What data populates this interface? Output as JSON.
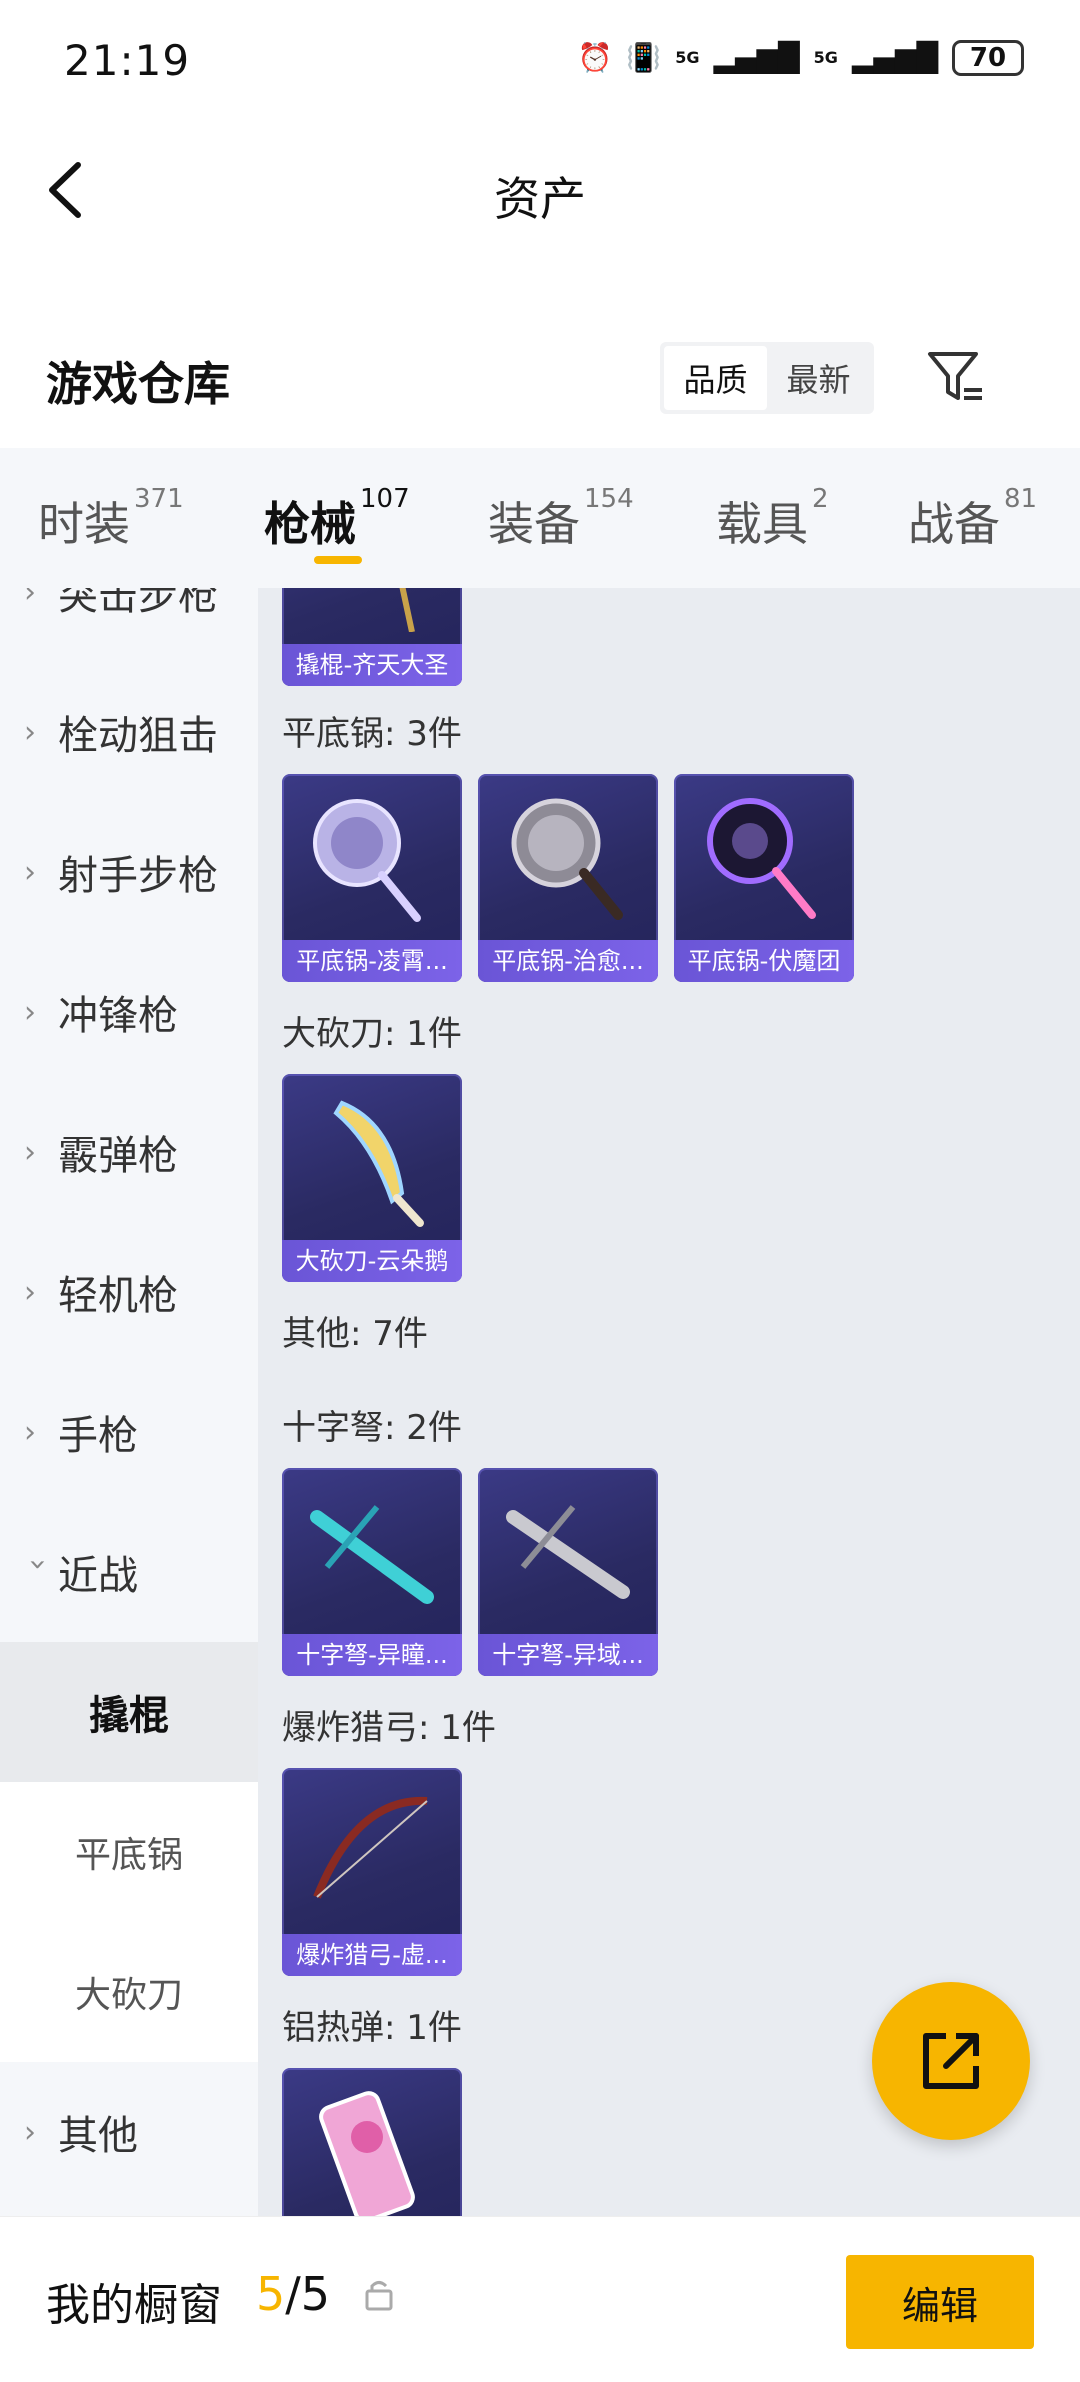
{
  "status_bar": {
    "time": "21:19",
    "signal1": "5G",
    "signal2": "5G",
    "battery": "70"
  },
  "header": {
    "title": "资产"
  },
  "warehouse": {
    "title": "游戏仓库",
    "sort_options": [
      "品质",
      "最新"
    ],
    "active_sort": "品质"
  },
  "tabs": [
    {
      "label": "时装",
      "count": "371"
    },
    {
      "label": "枪械",
      "count": "107"
    },
    {
      "label": "装备",
      "count": "154"
    },
    {
      "label": "载具",
      "count": "2"
    },
    {
      "label": "战备",
      "count": "81"
    }
  ],
  "active_tab": "枪械",
  "sidebar": {
    "items": [
      {
        "label": "突击步枪"
      },
      {
        "label": "栓动狙击"
      },
      {
        "label": "射手步枪"
      },
      {
        "label": "冲锋枪"
      },
      {
        "label": "霰弹枪"
      },
      {
        "label": "轻机枪"
      },
      {
        "label": "手枪"
      },
      {
        "label": "近战"
      },
      {
        "label": "其他"
      }
    ],
    "subitems": [
      {
        "label": "撬棍"
      },
      {
        "label": "平底锅"
      },
      {
        "label": "大砍刀"
      }
    ]
  },
  "main": {
    "top_card": "撬棍-齐天大圣",
    "groups": [
      {
        "label": "平底锅: 3件",
        "items": [
          "平底锅-凌霄...",
          "平底锅-治愈...",
          "平底锅-伏魔团"
        ]
      },
      {
        "label": "大砍刀: 1件",
        "items": [
          "大砍刀-云朵鹅"
        ]
      },
      {
        "label": "其他: 7件",
        "items": []
      },
      {
        "label": "十字弩: 2件",
        "items": [
          "十字弩-异瞳...",
          "十字弩-异域..."
        ]
      },
      {
        "label": "爆炸猎弓: 1件",
        "items": [
          "爆炸猎弓-虚..."
        ]
      },
      {
        "label": "铝热弹: 1件",
        "items": [
          ""
        ]
      }
    ]
  },
  "bottom": {
    "showcase_label": "我的橱窗",
    "showcase_used": "5",
    "showcase_total": "/5",
    "edit_label": "编辑"
  },
  "colors": {
    "accent": "#f7b500",
    "card_bg": "#2a2a62",
    "card_label_bg": "#6a55d6"
  }
}
